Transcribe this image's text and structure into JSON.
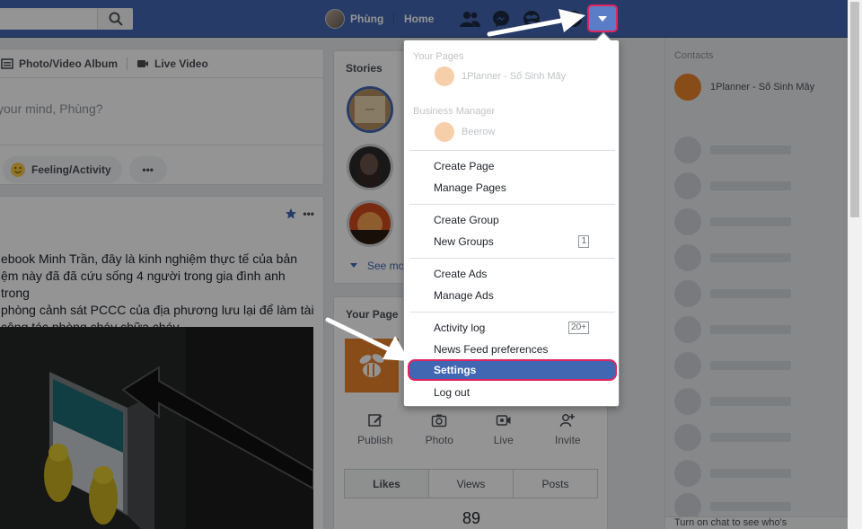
{
  "topbar": {
    "user_name": "Phùng",
    "home_label": "Home",
    "icons": [
      "search-icon",
      "friends-icon",
      "messenger-icon",
      "notifications-icon",
      "help-icon",
      "dropdown-caret-icon"
    ]
  },
  "composer": {
    "tab_album": "Photo/Video Album",
    "tab_live": "Live Video",
    "prompt": "your mind, Phùng?",
    "feeling_label": "Feeling/Activity",
    "more_label": "•••"
  },
  "post": {
    "more_label": "•••",
    "text": "ebook Minh Trần, đây là kinh nghiệm thực tế của bản\nệm này đã đã cứu sống 4 người trong gia đình anh trong\n phòng cảnh sát PCCC của địa phương lưu lại để làm tài\ncông tác phòng cháy chữa cháy."
  },
  "stories": {
    "title": "Stories",
    "see_more": "See mo"
  },
  "your_page": {
    "title": "Your Page",
    "actions": [
      {
        "label": "Publish",
        "icon": "edit-icon"
      },
      {
        "label": "Photo",
        "icon": "camera-icon"
      },
      {
        "label": "Live",
        "icon": "video-icon"
      },
      {
        "label": "Invite",
        "icon": "invite-icon"
      }
    ],
    "tabs": [
      "Likes",
      "Views",
      "Posts"
    ],
    "active_tab": "Likes",
    "count": "89"
  },
  "menu": {
    "your_pages_head": "Your Pages",
    "page_name": "1Planner - Số Sinh Mây",
    "business_head": "Business Manager",
    "business_name": "Beerow",
    "items": [
      {
        "label": "Create Page"
      },
      {
        "label": "Manage Pages"
      },
      {
        "label": "Create Group"
      },
      {
        "label": "New Groups",
        "badge": "1"
      },
      {
        "label": "Create Ads"
      },
      {
        "label": "Manage Ads"
      },
      {
        "label": "Activity log",
        "badge": "20+"
      },
      {
        "label": "News Feed preferences"
      },
      {
        "label": "Settings"
      },
      {
        "label": "Log out"
      }
    ]
  },
  "chat": {
    "head": "Contacts",
    "first_contact": "1Planner - Số Sinh Mây",
    "footer": "Turn on chat to see who's"
  },
  "colors": {
    "brand": "#4267b2",
    "highlight_border": "#e0245e",
    "page_orange": "#e8842a"
  }
}
